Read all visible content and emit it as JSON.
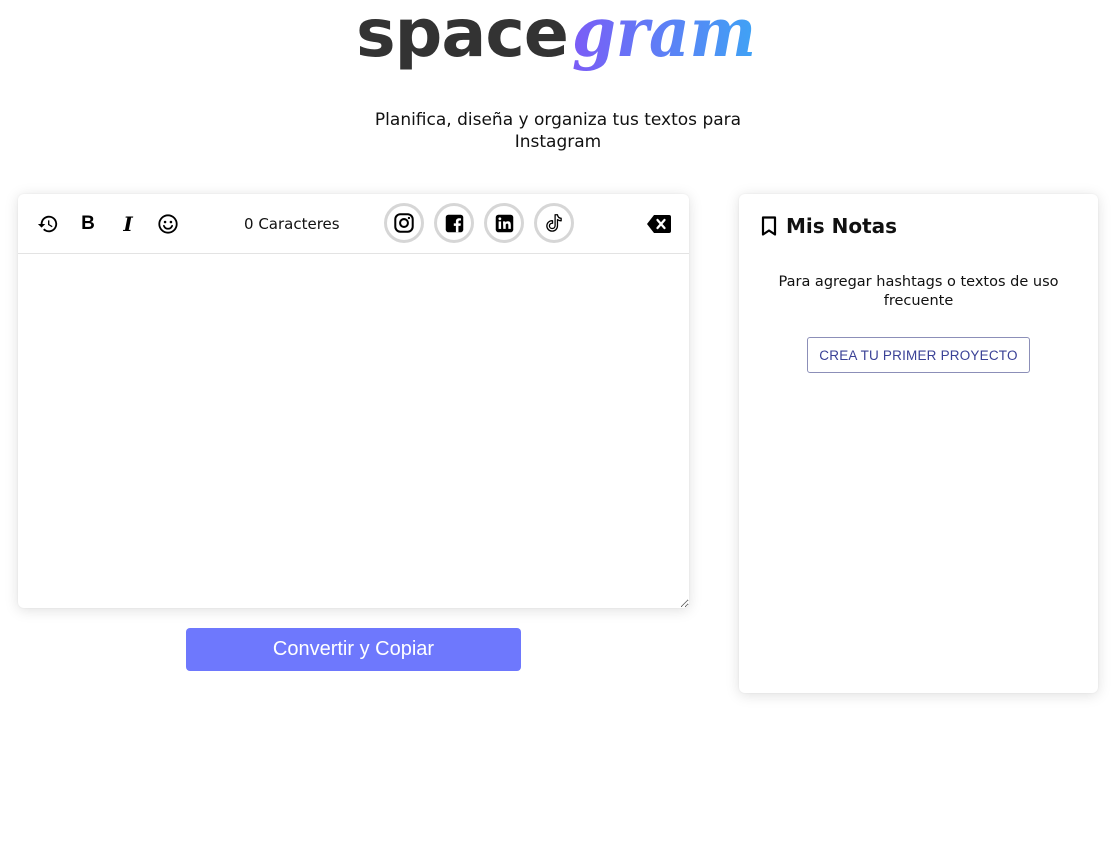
{
  "logo": {
    "part1": "space",
    "part2": "gram"
  },
  "tagline": "Planifica, diseña y organiza tus textos para Instagram",
  "editor": {
    "toolbar": {
      "history_icon": "history-icon",
      "bold_glyph": "B",
      "italic_glyph": "I",
      "emoji_icon": "emoji-icon",
      "char_count": "0",
      "char_label": "Caracteres",
      "socials": [
        "instagram-icon",
        "facebook-icon",
        "linkedin-icon",
        "tiktok-icon"
      ],
      "clear_icon": "backspace-icon"
    },
    "textarea_value": ""
  },
  "convert_button": "Convertir y Copiar",
  "notes": {
    "title": "Mis Notas",
    "description": "Para agregar hashtags o textos de uso frecuente",
    "create_button": "CREA TU PRIMER PROYECTO"
  },
  "colors": {
    "logo_dark": "#333333",
    "gradient_start": "#7b5cf6",
    "gradient_end": "#3fa3f5",
    "accent_button": "#6e78fd",
    "outline_button_text": "#3a4196"
  }
}
